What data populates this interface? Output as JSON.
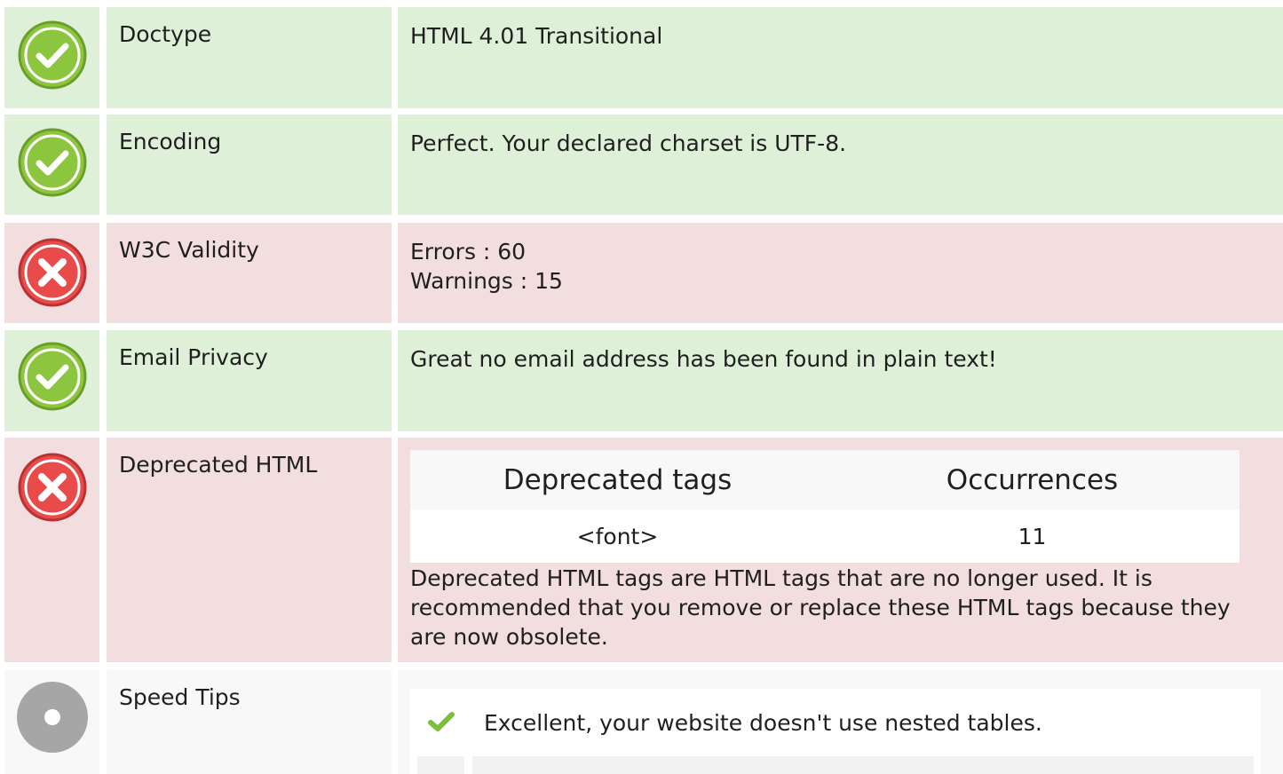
{
  "rows": [
    {
      "status": "pass",
      "status_icon": "check-circle-icon",
      "label": "Doctype",
      "value": "HTML 4.01 Transitional"
    },
    {
      "status": "pass",
      "status_icon": "check-circle-icon",
      "label": "Encoding",
      "value": "Perfect. Your declared charset is UTF-8."
    },
    {
      "status": "fail",
      "status_icon": "cross-circle-icon",
      "label": "W3C Validity",
      "value_lines": [
        "Errors : 60",
        "Warnings : 15"
      ]
    },
    {
      "status": "pass",
      "status_icon": "check-circle-icon",
      "label": "Email Privacy",
      "value": "Great no email address has been found in plain text!"
    },
    {
      "status": "fail",
      "status_icon": "cross-circle-icon",
      "label": "Deprecated HTML",
      "table": {
        "headers": [
          "Deprecated tags",
          "Occurrences"
        ],
        "rows": [
          [
            "<font>",
            "11"
          ]
        ]
      },
      "description": "Deprecated HTML tags are HTML tags that are no longer used. It is recommended that you remove or replace these HTML tags because they are now obsolete."
    },
    {
      "status": "neutral",
      "status_icon": "info-circle-icon",
      "label": "Speed Tips",
      "tips": [
        {
          "icon": "checkmark-icon",
          "text": "Excellent, your website doesn't use nested tables."
        }
      ]
    }
  ],
  "colors": {
    "pass_bg": "#dff0d8",
    "fail_bg": "#f2dede",
    "neutral_bg": "#f8f8f8",
    "pass_icon": "#8cc63f",
    "fail_icon": "#e94b4b",
    "neutral_icon": "#a6a6a6"
  }
}
